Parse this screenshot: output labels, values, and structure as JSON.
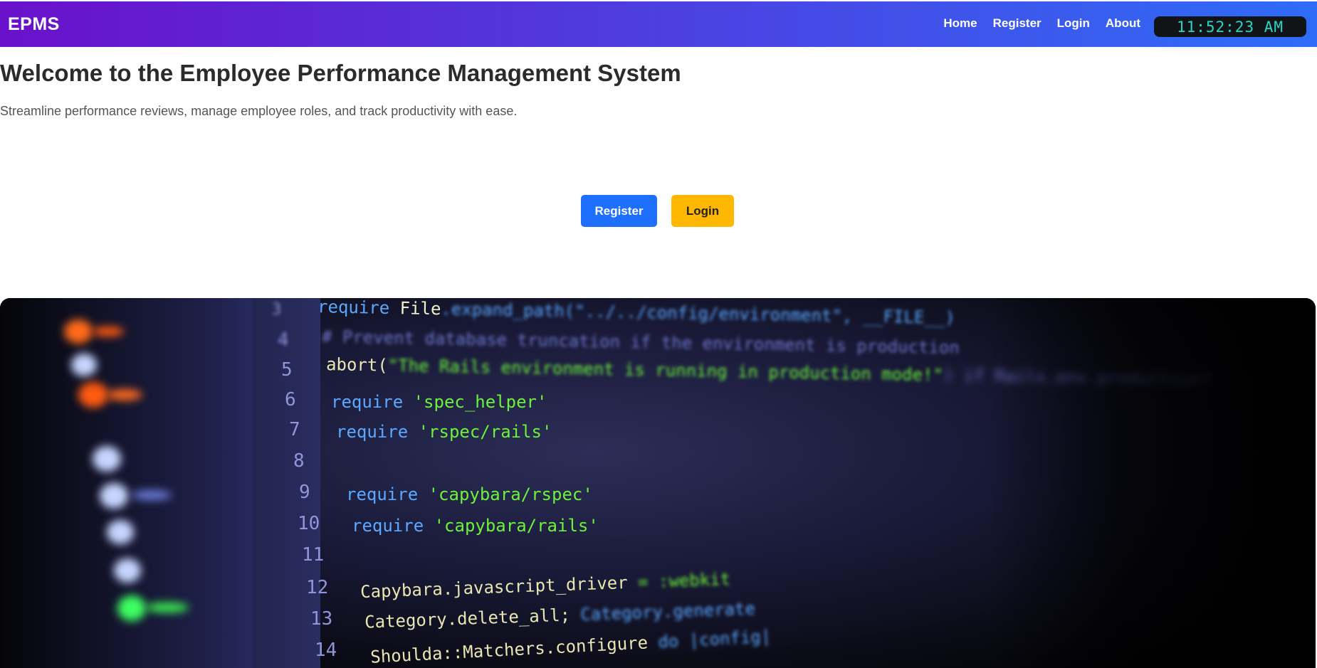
{
  "header": {
    "brand": "EPMS",
    "nav": [
      "Home",
      "Register",
      "Login",
      "About"
    ],
    "clock": "11:52:23 AM"
  },
  "hero": {
    "title": "Welcome to the Employee Performance Management System",
    "subtitle": "Streamline performance reviews, manage employee roles, and track productivity with ease.",
    "register_label": "Register",
    "login_label": "Login"
  },
  "code_image": {
    "line_numbers": [
      "3",
      "4",
      "5",
      "6",
      "7",
      "8",
      "9",
      "10",
      "11",
      "12",
      "13",
      "14"
    ],
    "lines": [
      {
        "kw": "require",
        "rest": " File",
        "rest2": ".expand_path(\"../../config/environment\", __FILE__)"
      },
      {
        "comment": "# Prevent database truncation if the environment is production"
      },
      {
        "fn": "abort(",
        "str": "\"The Rails environment is running in production mode!\"",
        "rest": ") if Rails.env.production?"
      },
      {
        "kw": "require",
        "str": " 'spec_helper'"
      },
      {
        "kw": "require",
        "str": " 'rspec/rails'"
      },
      {
        "kw": "",
        "str": ""
      },
      {
        "kw": "require",
        "str": " 'capybara/rspec'"
      },
      {
        "kw": "require",
        "str": " 'capybara/rails'"
      },
      {
        "kw": "",
        "str": ""
      },
      {
        "fn": "Capybara.javascript_driver",
        "rest": " = :webkit"
      },
      {
        "fn": "Category.delete_all;",
        "rest": " Category.generate"
      },
      {
        "fn": "Shoulda::Matchers.configure",
        "rest": " do |config|"
      }
    ]
  },
  "colors": {
    "nav_gradient_start": "#6a11cb",
    "nav_gradient_end": "#2f6df6",
    "register_button": "#1f6fff",
    "login_button": "#ffb700",
    "clock_text": "#25d6c8"
  }
}
